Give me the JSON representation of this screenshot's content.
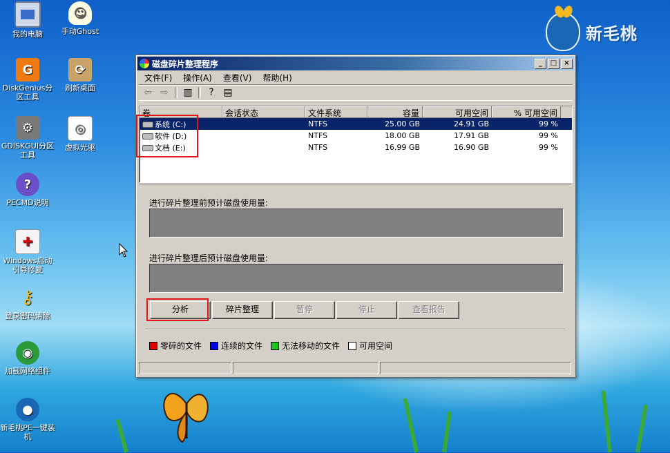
{
  "desktop": {
    "icons": [
      {
        "label": "我的电脑",
        "icon": "computer-icon"
      },
      {
        "label": "手动Ghost",
        "icon": "ghost-icon"
      },
      {
        "label": "DiskGenius分区工具",
        "icon": "diskgenius-icon"
      },
      {
        "label": "刷新桌面",
        "icon": "refresh-desktop-icon"
      },
      {
        "label": "GDISKGUI分区工具",
        "icon": "gdiskgui-icon"
      },
      {
        "label": "虚拟光驱",
        "icon": "virtual-drive-icon"
      },
      {
        "label": "PECMD说明",
        "icon": "help-icon"
      },
      {
        "label": "Windows启动引导修复",
        "icon": "boot-repair-icon"
      },
      {
        "label": "登录密码清除",
        "icon": "key-icon"
      },
      {
        "label": "加载网络组件",
        "icon": "network-icon"
      },
      {
        "label": "新毛桃PE一键装机",
        "icon": "installer-icon"
      }
    ],
    "brand": "新毛桃"
  },
  "window": {
    "title": "磁盘碎片整理程序",
    "menu": [
      "文件(F)",
      "操作(A)",
      "查看(V)",
      "帮助(H)"
    ],
    "columns": [
      "卷",
      "会话状态",
      "文件系统",
      "容量",
      "可用空间",
      "% 可用空间"
    ],
    "rows": [
      {
        "volume": "系统 (C:)",
        "status": "",
        "fs": "NTFS",
        "capacity": "25.00 GB",
        "free": "24.91 GB",
        "pct": "99 %"
      },
      {
        "volume": "软件 (D:)",
        "status": "",
        "fs": "NTFS",
        "capacity": "18.00 GB",
        "free": "17.91 GB",
        "pct": "99 %"
      },
      {
        "volume": "文档 (E:)",
        "status": "",
        "fs": "NTFS",
        "capacity": "16.99 GB",
        "free": "16.90 GB",
        "pct": "99 %"
      }
    ],
    "before_label": "进行碎片整理前预计磁盘使用量:",
    "after_label": "进行碎片整理后预计磁盘使用量:",
    "buttons": {
      "analyze": "分析",
      "defrag": "碎片整理",
      "pause": "暂停",
      "stop": "停止",
      "report": "查看报告"
    },
    "legend": [
      {
        "label": "零碎的文件",
        "color": "#e00000"
      },
      {
        "label": "连续的文件",
        "color": "#0000e0"
      },
      {
        "label": "无法移动的文件",
        "color": "#20c020"
      },
      {
        "label": "可用空间",
        "color": "#ffffff"
      }
    ]
  }
}
